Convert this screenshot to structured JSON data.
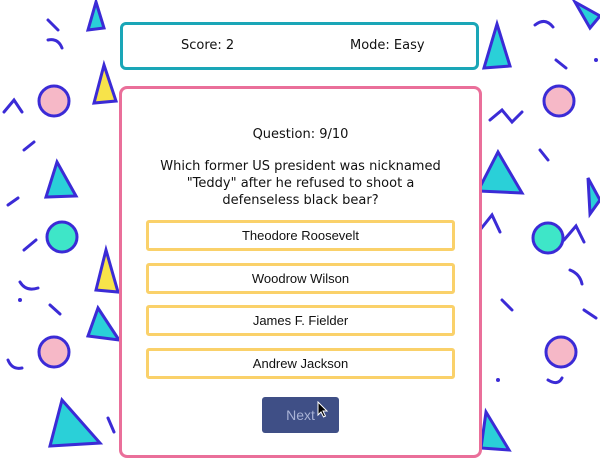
{
  "header": {
    "score": "Score: 2",
    "mode": "Mode: Easy"
  },
  "quiz": {
    "question_number": "Question: 9/10",
    "question_text": "Which former US president was nicknamed \"Teddy\" after he refused to shoot a defenseless black bear?",
    "answers": [
      "Theodore Roosevelt",
      "Woodrow Wilson",
      "James F. Fielder",
      "Andrew Jackson"
    ],
    "next_label": "Next"
  },
  "colors": {
    "score_border": "#1aa6b7",
    "quiz_border": "#ea6f9a",
    "answer_border": "#fad16a",
    "next_bg": "#3f4f86"
  }
}
